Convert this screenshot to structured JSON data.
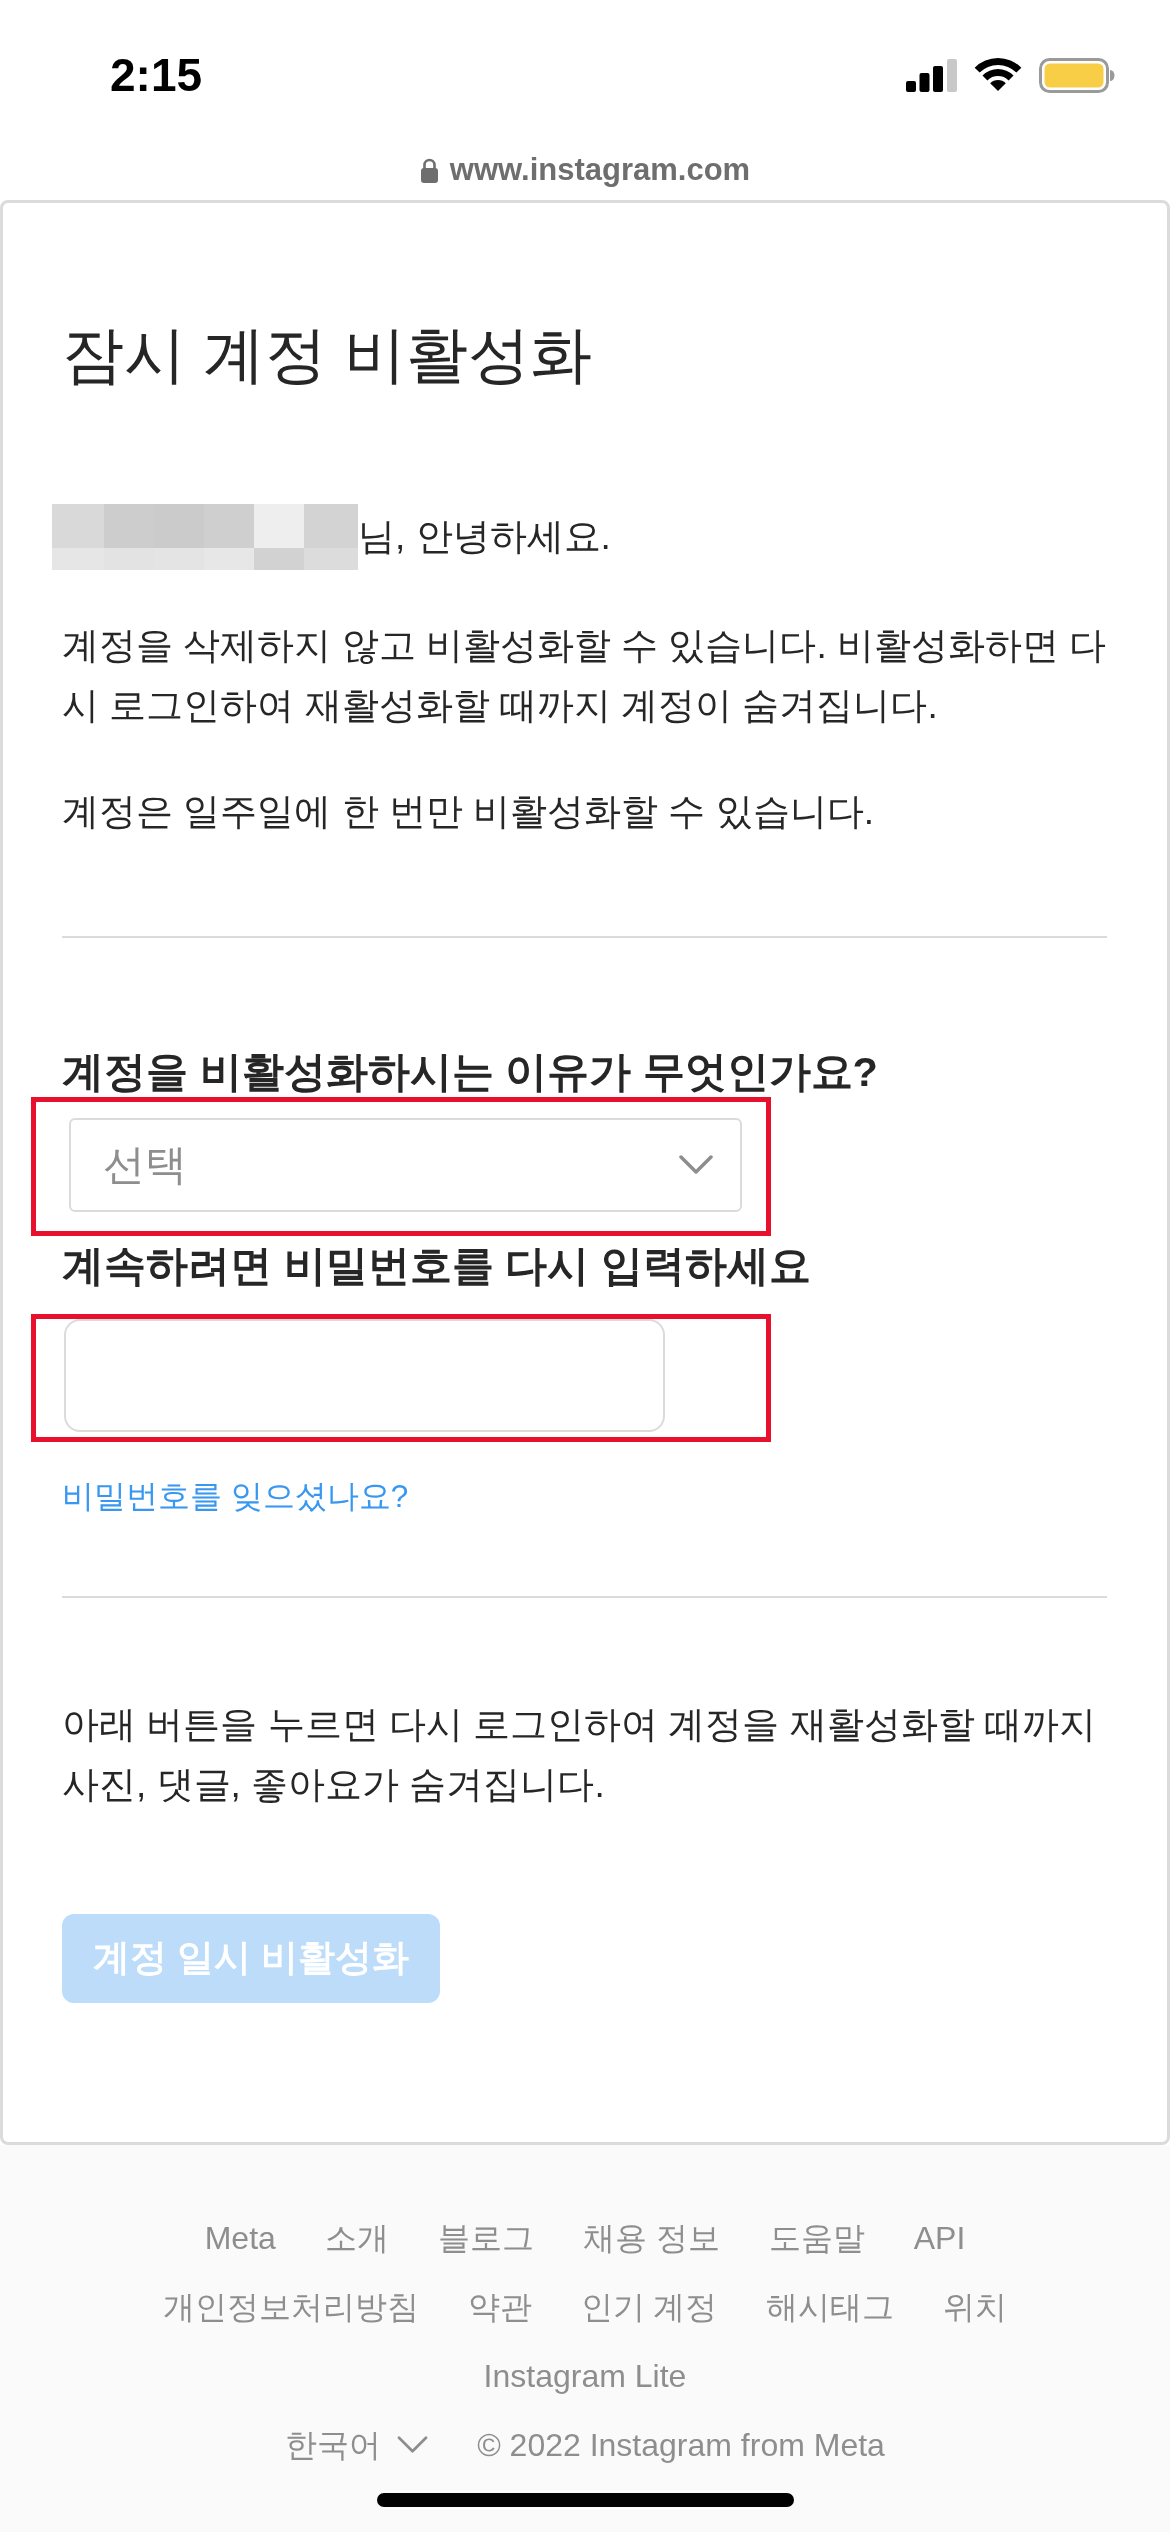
{
  "status_bar": {
    "time": "2:15"
  },
  "browser": {
    "url": "www.instagram.com"
  },
  "page": {
    "title": "잠시 계정 비활성화",
    "greeting": {
      "name_redacted": true,
      "text": "님, 안녕하세요."
    },
    "paragraphs": [
      "계정을 삭제하지 않고 비활성화할 수 있습니다. 비활성화하면 다시 로그인하여 재활성화할 때까지 계정이 숨겨집니다.",
      "계정은 일주일에 한 번만 비활성화할 수 있습니다."
    ],
    "reason": {
      "label": "계정을 비활성화하시는 이유가 무엇인가요?",
      "placeholder": "선택",
      "highlighted": true
    },
    "password": {
      "label": "계속하려면 비밀번호를 다시 입력하세요",
      "highlighted": true
    },
    "forgot_link": "비밀번호를 잊으셨나요?",
    "notice": "아래 버튼을 누르면 다시 로그인하여 계정을 재활성화할 때까지 사진, 댓글, 좋아요가 숨겨집니다.",
    "submit_button": {
      "label": "계정 일시 비활성화",
      "disabled": true
    }
  },
  "footer": {
    "link_rows": [
      [
        "Meta",
        "소개",
        "블로그",
        "채용 정보",
        "도움말",
        "API"
      ],
      [
        "개인정보처리방침",
        "약관",
        "인기 계정",
        "해시태그",
        "위치"
      ],
      [
        "Instagram Lite"
      ]
    ],
    "language": "한국어",
    "copyright": "© 2022 Instagram from Meta"
  }
}
